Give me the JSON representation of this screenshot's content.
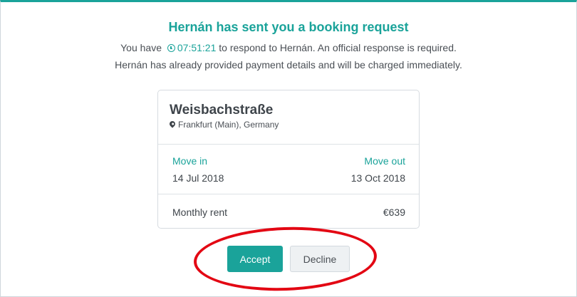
{
  "header": {
    "title": "Hernán has sent you a booking request",
    "line1_prefix": "You have",
    "timer": "07:51:21",
    "line1_suffix": "to respond to Hernán. An official response is required.",
    "line2": "Hernán has already provided payment details and will be charged immediately."
  },
  "listing": {
    "street": "Weisbachstraße",
    "location": "Frankfurt (Main), Germany"
  },
  "dates": {
    "move_in_label": "Move in",
    "move_in": "14 Jul 2018",
    "move_out_label": "Move out",
    "move_out": "13 Oct 2018"
  },
  "rent": {
    "label": "Monthly rent",
    "value": "€639"
  },
  "actions": {
    "accept": "Accept",
    "decline": "Decline"
  },
  "colors": {
    "accent": "#1aa39a",
    "highlight_ring": "#e30613"
  },
  "icons": {
    "timer": "clock-icon",
    "location": "map-pin-icon"
  }
}
